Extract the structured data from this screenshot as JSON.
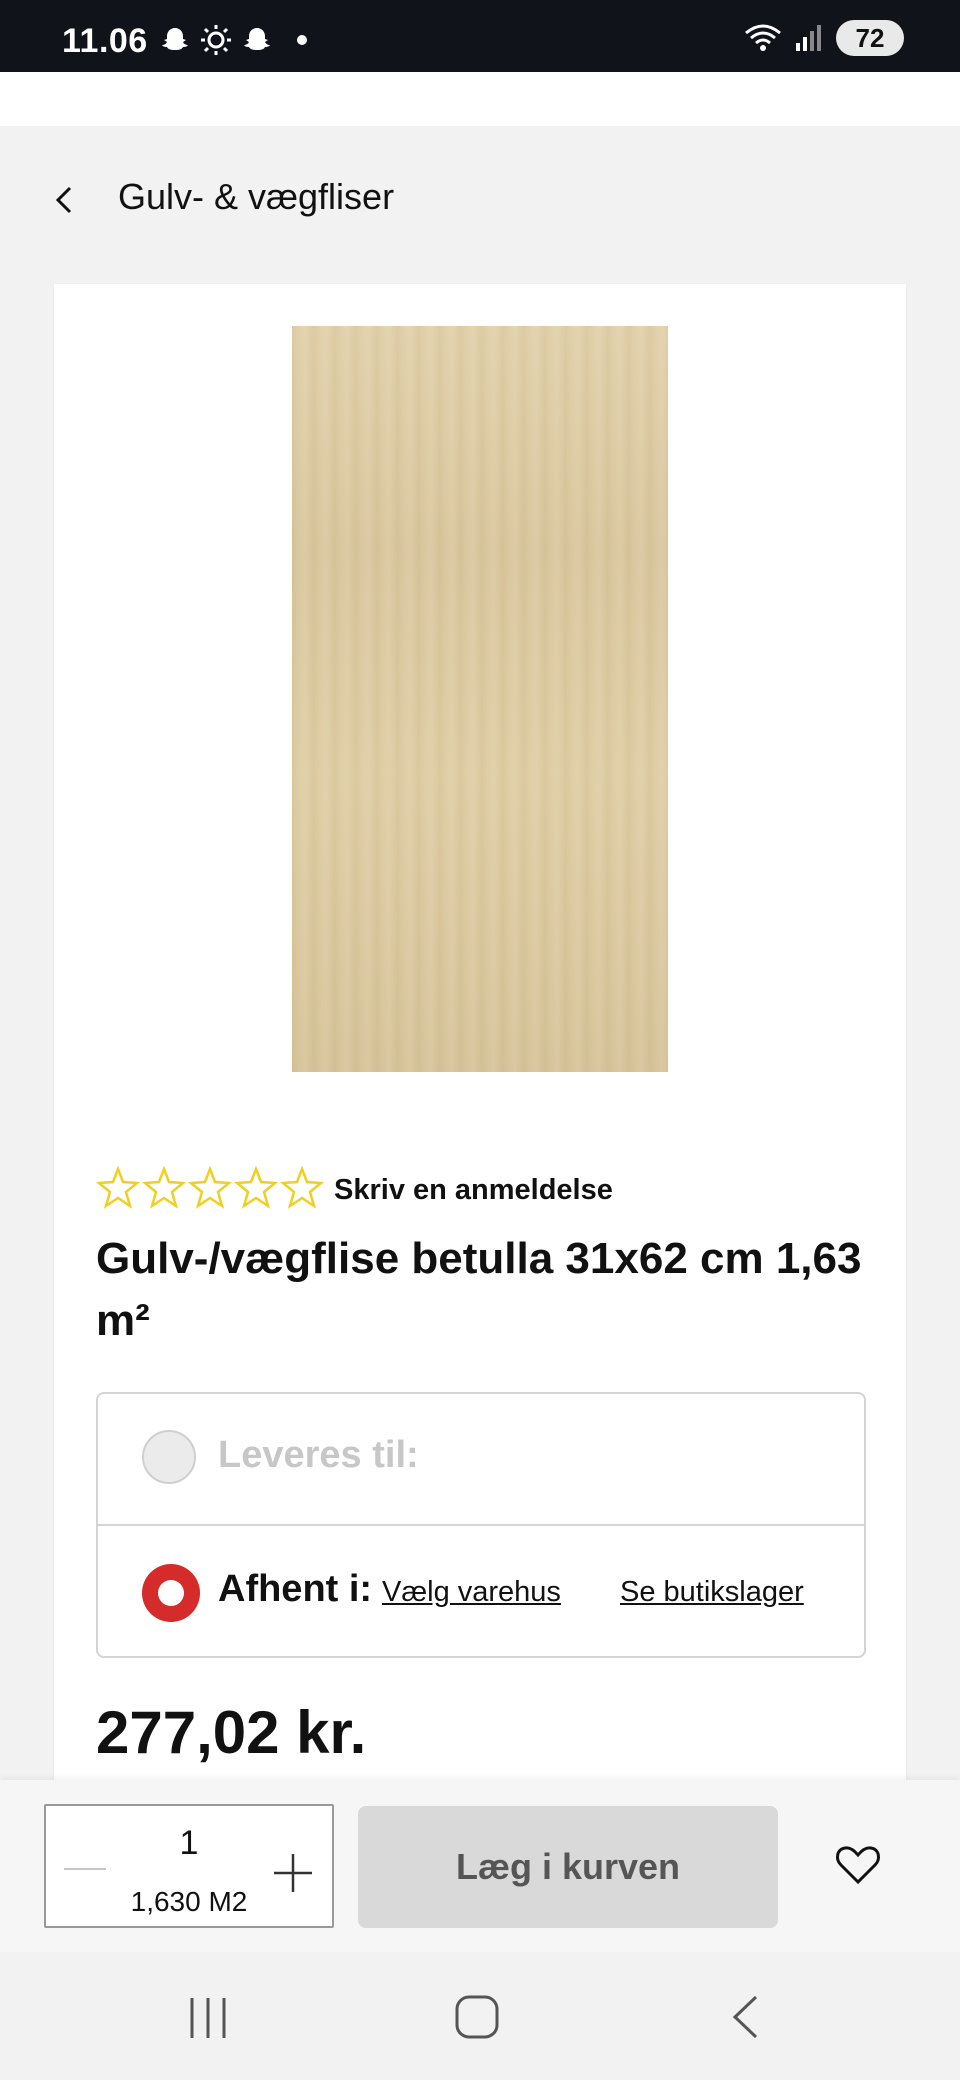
{
  "status_bar": {
    "time": "11.06",
    "battery": "72",
    "icons": [
      "snapchat-icon",
      "brightness-icon",
      "snapchat-icon",
      "dot-icon",
      "wifi-icon",
      "signal-icon",
      "battery-icon"
    ]
  },
  "breadcrumb": {
    "label": "Gulv- & vægfliser"
  },
  "product": {
    "image_alt_color": "#dccaa2",
    "rating_stars": 0,
    "rating_max": 5,
    "review_link": "Skriv en anmeldelse",
    "title": "Gulv-/vægflise betulla 31x62 cm 1,63 m²",
    "price": "277,02 kr."
  },
  "delivery": {
    "ship_label": "Leveres til:",
    "pickup_label": "Afhent i:",
    "choose_store_link": "Vælg varehus",
    "store_stock_link": "Se butikslager",
    "selected": "pickup",
    "accent_color": "#d52b2b"
  },
  "cart_bar": {
    "quantity": "1",
    "quantity_unit": "1,630 M2",
    "add_to_cart": "Læg i kurven"
  },
  "colors": {
    "status_bar": "#11131a",
    "background": "#f2f2f2",
    "button_disabled": "#d9d9d9"
  }
}
